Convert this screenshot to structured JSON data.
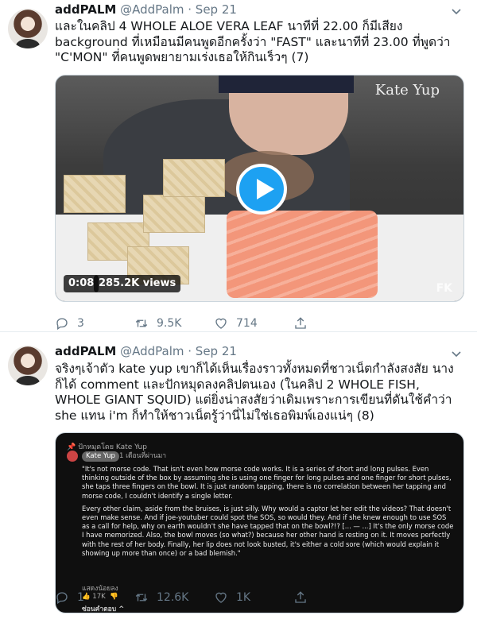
{
  "tweets": [
    {
      "name": "addPALM",
      "handle": "@AddPalm",
      "date": "· Sep 21",
      "text": "และในคลิป 4 WHOLE ALOE VERA LEAF นาทีที่ 22.00 ก็มีเสียง background ที่เหมือนมีคนพูดอีกครั้งว่า \"FAST\" และนาทีที่ 23.00 ที่พูดว่า \"C'MON\" ที่คนพูดพยายามเร่งเธอให้กินเร็วๆ (7)",
      "video": {
        "watermark": "Kate Yup",
        "corner_mark": "FK",
        "time": "0:08",
        "views": "285.2K views"
      },
      "actions": {
        "replies": "3",
        "retweets": "9.5K",
        "likes": "714"
      }
    },
    {
      "name": "addPALM",
      "handle": "@AddPalm",
      "date": "· Sep 21",
      "text": "จริงๆเจ้าตัว kate yup เขาก็ได้เห็นเรื่องราวทั้งหมดที่ชาวเน็ตกำลังสงสัย นางก็ได้ comment และปักหมุดลงคลิปตนเอง (ในคลิป 2 WHOLE FISH, WHOLE GIANT SQUID) แต่ยิ่งน่าสงสัยว่าเดิมเพราะการเขียนที่ดันใช้คำว่า she แทน i'm ก็ทำให้ชาวเน็ตรู้ว่านี่ไม่ใช่เธอพิมพ์เองแน่ๆ (8)",
      "screenshot": {
        "pinned": "ปักหมุดโดย Kate Yup",
        "author": "Kate Yup",
        "ago": "1 เดือนที่ผ่านมา",
        "paragraphs": [
          "\"It's not morse code. That isn't even how morse code works. It is a series of short and long pulses. Even thinking outside of the box by assuming she is using one finger for long pulses and one finger for short pulses, she taps three fingers on the bowl. It is just random tapping, there is no correlation between her tapping and morse code, I couldn't identify a single letter.",
          "Every other claim, aside from the bruises, is just silly. Why would a captor let her edit the videos? That doesn't even make sense. And if joe-youtuber could spot the SOS, so would they. And if she knew enough to use SOS as a call for help, why on earth wouldn't she have tapped that on the bowl?!? [... — ...] It's the only morse code I have memorized. Also, the bowl moves (so what?) because her other hand is resting on it. It moves perfectly with the rest of her body. Finally, her lip does not look busted, it's either a cold sore (which would explain it showing up more than once) or a bad blemish.\""
        ],
        "read_more": "แสดงน้อยลง",
        "likes": "17K",
        "hide_replies": "ซ่อนคำตอบ ^"
      },
      "actions": {
        "replies": "1",
        "retweets": "12.6K",
        "likes": "1K"
      }
    }
  ],
  "colors": {
    "twitter_blue": "#1da1f2",
    "muted": "#657786"
  }
}
